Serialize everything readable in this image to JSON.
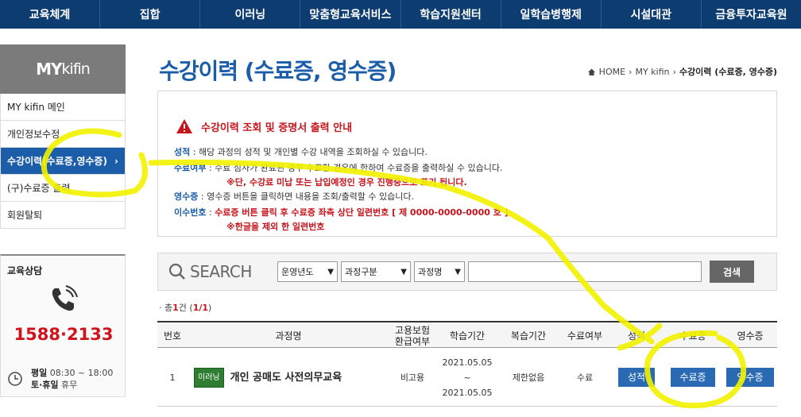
{
  "topnav": [
    "교육체계",
    "집합",
    "이러닝",
    "맞춤형교육서비스",
    "학습지원센터",
    "일학습병행제",
    "시설대관",
    "금융투자교육원"
  ],
  "sidebar": {
    "header_my": "MY",
    "header_kifin": "kifin",
    "items": [
      {
        "label": "MY kifin 메인"
      },
      {
        "label": "개인정보수정"
      },
      {
        "label": "수강이력(수료증,영수증)",
        "chevron": "›"
      },
      {
        "label": "(구)수료증 출력"
      },
      {
        "label": "회원탈퇴"
      }
    ],
    "contact": {
      "title": "교육상담",
      "phone": "1588·2133",
      "weekday_label": "평일",
      "weekday_hours": "08:30 ~ 18:00",
      "weekend_label": "토·휴일",
      "weekend_hours": "휴무"
    }
  },
  "page": {
    "title": "수강이력 (수료증, 영수증)",
    "breadcrumb": [
      "HOME",
      "MY kifin",
      "수강이력 (수료증, 영수증)"
    ]
  },
  "notice": {
    "title": "수강이력 조회 및 증명서 출력 안내",
    "lines": [
      {
        "key": "성적",
        "text": " : 해당 과정의 성적 및 개인별 수강 내역을 조회하실 수 있습니다."
      },
      {
        "key": "수료여부",
        "text": " : 수료 심사가 완료된 경우 수료한 경우에 한하여 수료증을 출력하실 수 있습니다."
      },
      {
        "red": "※단, 수강료 미납 또는 납입예정인 경우 진행중으로 표기 됩니다."
      },
      {
        "key": "영수증",
        "text": " : 영수증 버튼을 클릭하면 내용을 조회/출력할 수 있습니다."
      },
      {
        "key": "이수번호",
        "text": " : ",
        "red": "수료증 버튼 클릭 후 수료증 좌측 상단 일련번호 [ 제 0000-0000-0000 호 ]"
      },
      {
        "red": "※한글을 제외 한 일련번호"
      }
    ]
  },
  "search": {
    "label": "SEARCH",
    "selects": [
      "운영년도",
      "과정구분",
      "과정명"
    ],
    "input_value": "",
    "button": "검색"
  },
  "count": {
    "prefix": "· 총",
    "total": "1",
    "suffix": "건 (",
    "page": "1/1",
    "end": ")"
  },
  "table": {
    "headers": [
      "번호",
      "과정명",
      "고용보험\n환급여부",
      "학습기간",
      "복습기간",
      "수료여부",
      "성적",
      "수료증",
      "영수증"
    ],
    "rows": [
      {
        "no": "1",
        "badge": "이러닝",
        "course": "개인 공매도 사전의무교육",
        "insurance": "비고용",
        "period_start": "2021.05.05",
        "period_sep": "~",
        "period_end": "2021.05.05",
        "review": "제한없음",
        "status": "수료",
        "grade_btn": "성적",
        "cert_btn": "수료증",
        "receipt_btn": "영수증"
      }
    ]
  },
  "colors": {
    "nav": "#0c3c70",
    "accent": "#1c5da9",
    "alert": "#c8141c",
    "highlight": "#f2f200"
  }
}
